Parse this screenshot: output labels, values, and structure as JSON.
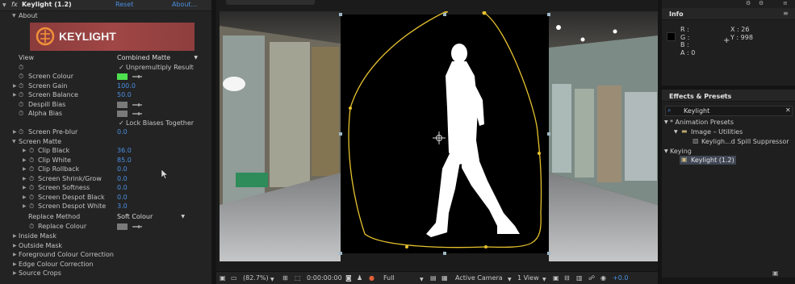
{
  "effect_controls": {
    "header": {
      "fx_label": "fx",
      "effect_name": "Keylight (1.2)",
      "reset_label": "Reset",
      "about_link": "About..."
    },
    "about_label": "About",
    "logo_text": "KEYLIGHT",
    "view": {
      "label": "View",
      "value": "Combined Matte"
    },
    "unpremultiply": {
      "checked_mark": "✓",
      "label": "Unpremultiply Result"
    },
    "screen_colour": {
      "label": "Screen Colour",
      "color": "#4ee04e"
    },
    "screen_gain": {
      "label": "Screen Gain",
      "value": "100.0"
    },
    "screen_balance": {
      "label": "Screen Balance",
      "value": "50.0"
    },
    "despill_bias": {
      "label": "Despill Bias",
      "color": "#7a7a7a"
    },
    "alpha_bias": {
      "label": "Alpha Bias",
      "color": "#7a7a7a"
    },
    "lock_biases": {
      "checked_mark": "✓",
      "label": "Lock Biases Together"
    },
    "screen_preblur": {
      "label": "Screen Pre-blur",
      "value": "0.0"
    },
    "screen_matte": {
      "label": "Screen Matte",
      "params": [
        {
          "label": "Clip Black",
          "value": "36.0"
        },
        {
          "label": "Clip White",
          "value": "85.0"
        },
        {
          "label": "Clip Rollback",
          "value": "0.0"
        },
        {
          "label": "Screen Shrink/Grow",
          "value": "0.0"
        },
        {
          "label": "Screen Softness",
          "value": "0.0"
        },
        {
          "label": "Screen Despot Black",
          "value": "0.0"
        },
        {
          "label": "Screen Despot White",
          "value": "3.0"
        }
      ],
      "replace_method": {
        "label": "Replace Method",
        "value": "Soft Colour"
      },
      "replace_colour": {
        "label": "Replace Colour",
        "color": "#7a7a7a"
      }
    },
    "groups": [
      "Inside Mask",
      "Outside Mask",
      "Foreground Colour Correction",
      "Edge Colour Correction",
      "Source Crops"
    ]
  },
  "viewer": {
    "toolbar": {
      "zoom": "(82.7%)",
      "timecode": "0:00:00:00",
      "resolution": "Full",
      "camera": "Active Camera",
      "views": "1 View",
      "exposure": "+0.0"
    }
  },
  "info_panel": {
    "title": "Info",
    "r": "R :",
    "g": "G :",
    "b": "B :",
    "a": "A : 0",
    "x": "X : 26",
    "y": "Y : 998"
  },
  "effects_presets": {
    "title": "Effects & Presets",
    "search_value": "Keylight",
    "tree": {
      "animation_presets": "* Animation Presets",
      "image_utilities": "Image – Utilities",
      "preset_item": "Keyligh...d Spill Suppressor",
      "keying": "Keying",
      "keylight_item": "Keylight (1.2)"
    }
  },
  "colors": {
    "accent_blue": "#4a8fe0",
    "mask_path": "#e6c22e",
    "selection": "#3f4654"
  }
}
